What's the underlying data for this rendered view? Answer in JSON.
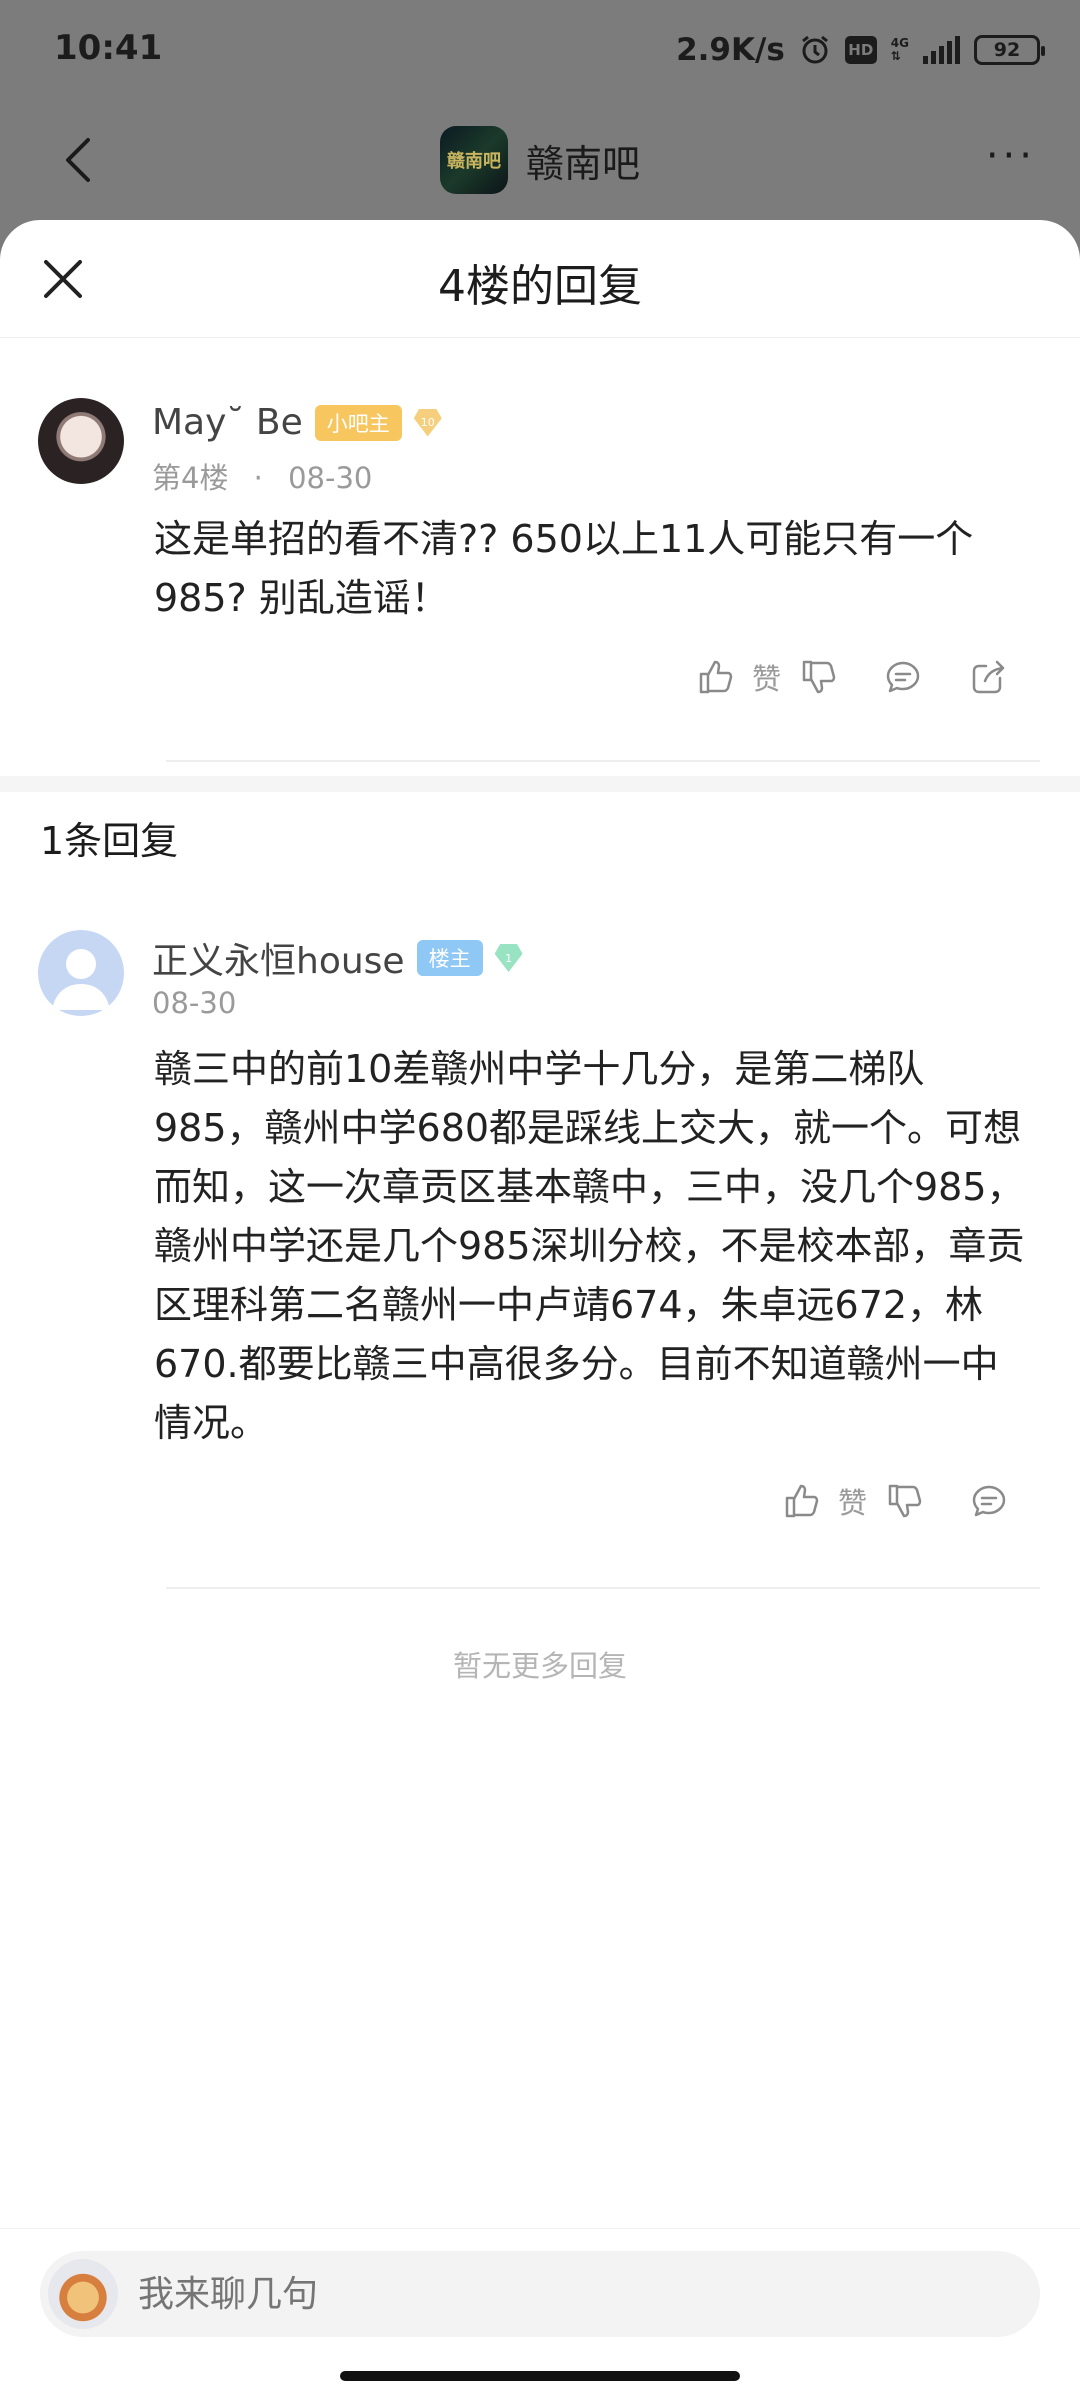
{
  "status_bar": {
    "time": "10:41",
    "net_speed": "2.9K/s",
    "hd": "HD",
    "network": "4G",
    "battery": "92"
  },
  "nav": {
    "avatar_text": "赣南吧",
    "title": "赣南吧",
    "more": "···"
  },
  "sheet": {
    "title": "4楼的回复"
  },
  "post": {
    "username": "May˘ Be",
    "badge": "小吧主",
    "level": "10",
    "floor": "第4楼",
    "dot": "·",
    "date": "08-30",
    "content": "这是单招的看不清?? 650以上11人可能只有一个985? 别乱造谣！",
    "like_label": "赞"
  },
  "replies": {
    "count_title": "1条回复",
    "items": [
      {
        "username": "正义永恒house",
        "badge": "楼主",
        "level": "1",
        "date": "08-30",
        "content": "赣三中的前10差赣州中学十几分，是第二梯队985，赣州中学680都是踩线上交大，就一个。可想而知，这一次章贡区基本赣中，三中，没几个985，赣州中学还是几个985深圳分校，不是校本部，章贡区理科第二名赣州一中卢靖674，朱卓远672，林670.都要比赣三中高很多分。目前不知道赣州一中情况。",
        "like_label": "赞"
      }
    ],
    "no_more": "暂无更多回复"
  },
  "input": {
    "placeholder": "我来聊几句"
  },
  "colors": {
    "badge_mod": "#f8c65e",
    "badge_op": "#8fc7f5",
    "meta_gray": "#9a9a9a",
    "dim_overlay": "#7c7c7c"
  }
}
